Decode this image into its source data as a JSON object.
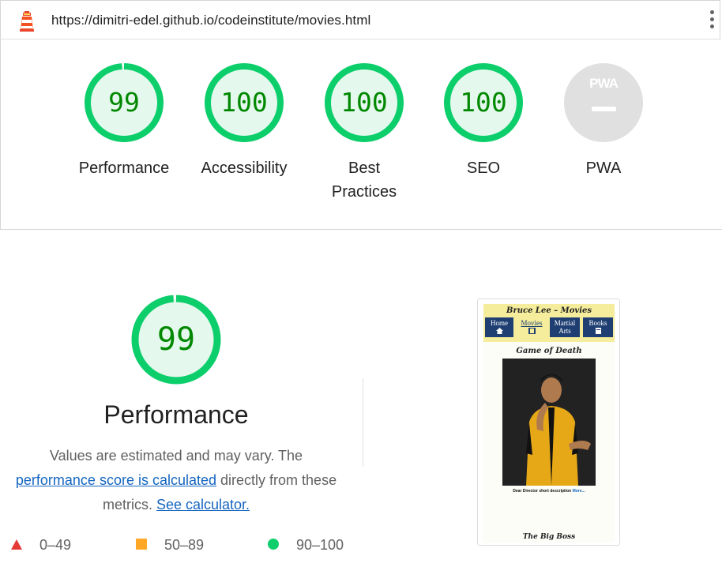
{
  "browser": {
    "url": "https://dimitri-edel.github.io/codeinstitute/movies.html",
    "logo_icon": "lighthouse-icon",
    "menu_icon": "vertical-dots-icon"
  },
  "scores": [
    {
      "value": "99",
      "label": "Performance"
    },
    {
      "value": "100",
      "label": "Accessibility"
    },
    {
      "value": "100",
      "label_line1": "Best",
      "label_line2": "Practices"
    },
    {
      "value": "100",
      "label": "SEO"
    }
  ],
  "pwa": {
    "badge_text": "PWA",
    "label": "PWA"
  },
  "colors": {
    "pass": "#0cce6b",
    "pass_fill": "#e5f8ee",
    "pass_text": "#008800",
    "average": "#ffa726",
    "fail": "#e53935",
    "neutral": "#e0e0e0"
  },
  "detail": {
    "score": "99",
    "title": "Performance",
    "desc_part1": "Values are estimated and may vary. The",
    "desc_link1": "performance score is calculated",
    "desc_part2": "directly from these",
    "desc_part3": "metrics.",
    "desc_link2": "See calculator."
  },
  "legend": [
    {
      "range": "0–49",
      "icon": "red-triangle-icon"
    },
    {
      "range": "50–89",
      "icon": "orange-square-icon"
    },
    {
      "range": "90–100",
      "icon": "green-circle-icon"
    }
  ],
  "thumbnail": {
    "site_title": "Bruce Lee – Movies",
    "nav": [
      "Home",
      "Movies",
      "Martial",
      "Arts",
      "Books"
    ],
    "movie_title": "Game of Death",
    "caption": "Dear Director short description",
    "caption_link": "More...",
    "next_title": "The Big Boss"
  }
}
